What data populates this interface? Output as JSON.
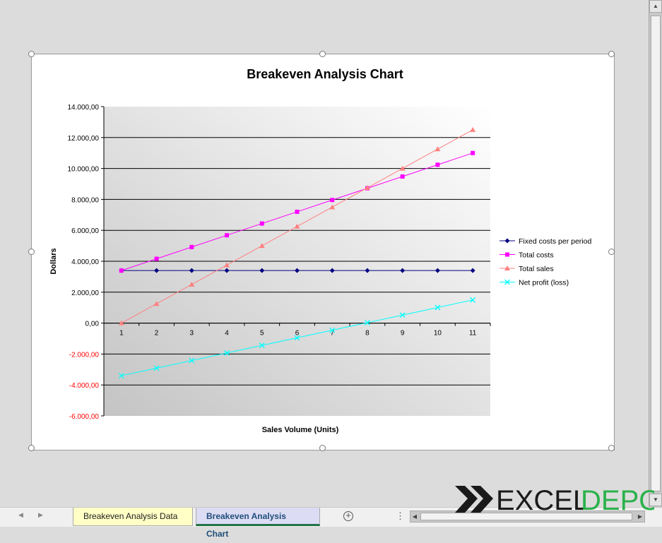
{
  "colors": {
    "fixed": "#000080",
    "costs": "#ff00ff",
    "sales": "#ff8080",
    "profit": "#00ffff",
    "neg_tick": "#ff0000",
    "logo_green": "#2bb24c"
  },
  "chart_data": {
    "type": "line",
    "title": "Breakeven Analysis Chart",
    "xlabel": "Sales Volume (Units)",
    "ylabel": "Dollars",
    "categories": [
      "1",
      "2",
      "3",
      "4",
      "5",
      "6",
      "7",
      "8",
      "9",
      "10",
      "11"
    ],
    "y_ticks": [
      "14.000,00",
      "12.000,00",
      "10.000,00",
      "8.000,00",
      "6.000,00",
      "4.000,00",
      "2.000,00",
      "0,00",
      "-2.000,00",
      "-4.000,00",
      "-6.000,00"
    ],
    "ylim": [
      -6000,
      14000
    ],
    "legend_position": "right",
    "grid": "horizontal",
    "series": [
      {
        "name": "Fixed costs per period",
        "marker": "diamond",
        "values": [
          3400,
          3400,
          3400,
          3400,
          3400,
          3400,
          3400,
          3400,
          3400,
          3400,
          3400
        ]
      },
      {
        "name": "Total costs",
        "marker": "square",
        "values": [
          3400,
          4160,
          4920,
          5680,
          6440,
          7200,
          7960,
          8720,
          9480,
          10240,
          11000
        ]
      },
      {
        "name": "Total sales",
        "marker": "triangle",
        "values": [
          0,
          1250,
          2500,
          3750,
          5000,
          6250,
          7500,
          8750,
          10000,
          11250,
          12500
        ]
      },
      {
        "name": "Net profit (loss)",
        "marker": "x",
        "values": [
          -3400,
          -2910,
          -2420,
          -1930,
          -1440,
          -950,
          -460,
          30,
          520,
          1010,
          1500
        ]
      }
    ]
  },
  "tabs": [
    {
      "label": "Breakeven Analysis Data"
    },
    {
      "label": "Breakeven Analysis Chart"
    }
  ],
  "icons": {
    "add_sheet": "plus-circle-icon",
    "prev": "triangle-left-icon",
    "next": "triangle-right-icon",
    "more": "vertical-ellipsis-icon"
  },
  "logo": {
    "text_excel": "EXCEL",
    "text_depo": "DEPO"
  }
}
